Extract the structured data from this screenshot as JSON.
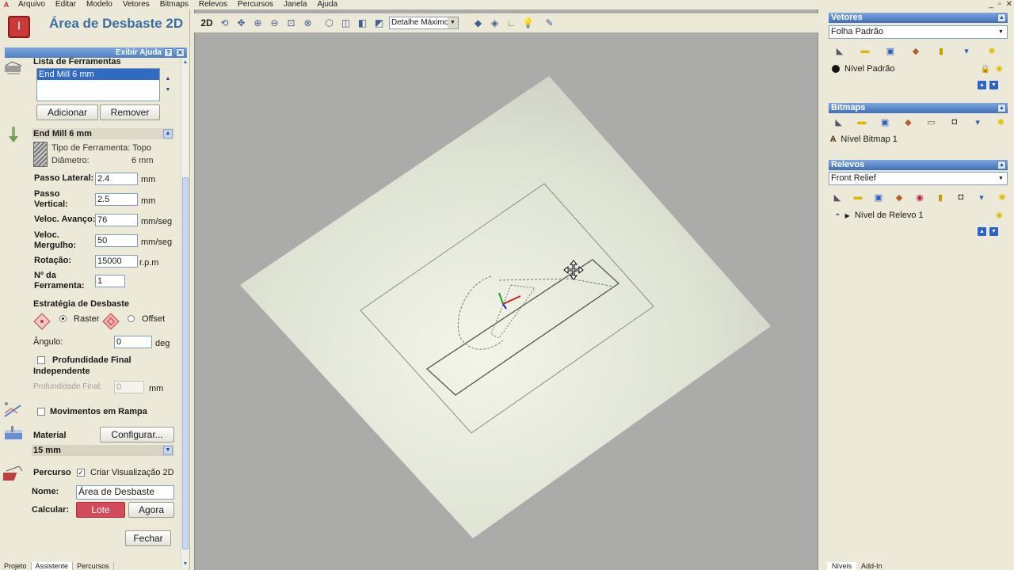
{
  "menubar": {
    "items": [
      "Arquivo",
      "Editar",
      "Modelo",
      "Vetores",
      "Bitmaps",
      "Relevos",
      "Percursos",
      "Janela",
      "Ajuda"
    ],
    "window_controls": [
      "_",
      "▫",
      "✕"
    ]
  },
  "left_panel": {
    "title": "Área de Desbaste 2D",
    "help_label": "Exibir Ajuda",
    "help_btn": "?",
    "close_btn": "✕",
    "tool_list": {
      "label": "Lista de Ferramentas",
      "items": [
        "End Mill 6 mm"
      ],
      "add_label": "Adicionar",
      "remove_label": "Remover"
    },
    "tool": {
      "name": "End Mill 6 mm",
      "type_label": "Tipo de Ferramenta:",
      "type_value": "Topo",
      "diameter_label": "Diâmetro:",
      "diameter_value": "6 mm"
    },
    "params": {
      "passo_lateral_label": "Passo Lateral:",
      "passo_lateral_value": "2.4",
      "passo_lateral_unit": "mm",
      "passo_vertical_label1": "Passo",
      "passo_vertical_label2": "Vertical:",
      "passo_vertical_value": "2.5",
      "passo_vertical_unit": "mm",
      "avanco_label": "Veloc. Avanço:",
      "avanco_value": "76",
      "avanco_unit": "mm/seg",
      "mergulho_label1": "Veloc.",
      "mergulho_label2": "Mergulho:",
      "mergulho_value": "50",
      "mergulho_unit": "mm/seg",
      "rotacao_label": "Rotação:",
      "rotacao_value": "15000",
      "rotacao_unit": "r.p.m",
      "ferramenta_label1": "Nº da",
      "ferramenta_label2": "Ferramenta:",
      "ferramenta_value": "1"
    },
    "strategy": {
      "label": "Estratégia de Desbaste",
      "raster_label": "Raster",
      "offset_label": "Offset",
      "selected": "Raster",
      "angle_label": "Ângulo:",
      "angle_value": "0",
      "angle_unit": "deg"
    },
    "final_depth": {
      "label1": "Profundidade Final",
      "label2": "Independente",
      "field_label": "Profundidade Final:",
      "field_value": "0",
      "field_unit": "mm",
      "checked": false
    },
    "ramp": {
      "label": "Movimentos em Rampa",
      "checked": false
    },
    "material": {
      "label": "Material",
      "configure_label": "Configurar...",
      "thickness": "15 mm"
    },
    "toolpath": {
      "label": "Percurso",
      "preview_label": "Criar Visualização 2D",
      "preview_checked": true,
      "name_label": "Nome:",
      "name_value": "Área de Desbaste",
      "calc_label": "Calcular:",
      "batch_label": "Lote",
      "now_label": "Agora",
      "close_label": "Fechar"
    },
    "tabs": [
      "Projeto",
      "Assistente",
      "Percursos"
    ]
  },
  "toolbar": {
    "mode_2d": "2D",
    "detail_value": "Detalhe Máximo"
  },
  "right_panel": {
    "vectors": {
      "title": "Vetores",
      "sheet": "Folha Padrão",
      "layer": "Nível Padrão"
    },
    "bitmaps": {
      "title": "Bitmaps",
      "layer": "Nível Bitmap 1"
    },
    "reliefs": {
      "title": "Relevos",
      "relief": "Front Relief",
      "layer": "Nível de Relevo 1"
    },
    "tabs": [
      "Níveis",
      "Add-In"
    ]
  },
  "colors": {
    "accent_blue": "#3a6ea5",
    "title_bar": "#4f7fc4",
    "batch_button": "#d24b5a",
    "viewport_bg": "#abacaa"
  }
}
